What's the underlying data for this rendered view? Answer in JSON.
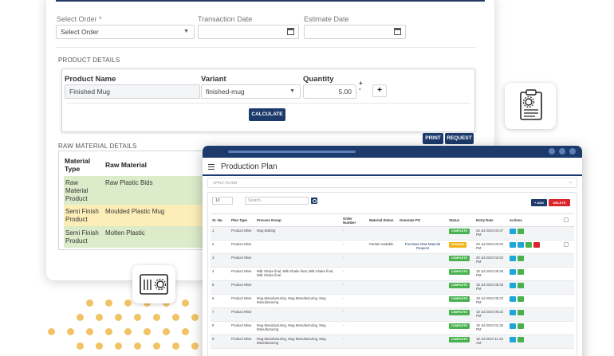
{
  "order_form": {
    "select_order_label": "Select Order *",
    "select_order_value": "Select Order",
    "transaction_date_label": "Transaction Date",
    "estimate_date_label": "Estimate Date",
    "product_details_title": "PRODUCT DETAILS",
    "product": {
      "name_header": "Product Name",
      "variant_header": "Variant",
      "quantity_header": "Quantity",
      "name_value": "Finished Mug",
      "variant_value": "finished-mug",
      "quantity_value": "5.00",
      "plus_label": "+",
      "step_up": "+",
      "step_down": "-"
    },
    "calculate_label": "CALCULATE",
    "print_label": "PRINT",
    "request_label": "REQUEST",
    "raw_material_title": "RAW MATERIAL DETAILS",
    "raw_material": {
      "col_type": "Material Type",
      "col_raw": "Raw Material",
      "rows": [
        {
          "type": "Raw Material Product",
          "name": "Raw Plastic Bids"
        },
        {
          "type": "Semi Finish Product",
          "name": "Moulded Plastic Mug"
        },
        {
          "type": "Semi Finish Product",
          "name": "Molten Plastic"
        }
      ]
    }
  },
  "production_plan": {
    "title": "Production Plan",
    "filter_label": "APPLY FILTER",
    "page_size": "10",
    "search_placeholder": "Search..",
    "add_label": "+ ADD",
    "delete_label": "DELETE",
    "columns": [
      "Sr. No.",
      "Plan Type",
      "Process Group",
      "Order Number",
      "Material Status",
      "Generate PO",
      "Status",
      "Entry Date",
      "Actions"
    ],
    "rows": [
      {
        "sr": "1",
        "plan_type": "Product Wise",
        "process_group": "Mug Making",
        "order_number": "-",
        "material_status": "",
        "generate_po": "",
        "status": "COMPLETE",
        "entry_date": "26 Jul 2024 04:27 PM"
      },
      {
        "sr": "2",
        "plan_type": "Product Wise",
        "process_group": "",
        "order_number": "-",
        "material_status": "Partial Available",
        "generate_po": "Purchase Raw Material Request",
        "status": "PENDING",
        "entry_date": "20 Jul 2024 02:02 PM"
      },
      {
        "sr": "3",
        "plan_type": "Product Wise",
        "process_group": "",
        "order_number": "-",
        "material_status": "",
        "generate_po": "",
        "status": "COMPLETE",
        "entry_date": "20 Jul 2024 02:02 PM"
      },
      {
        "sr": "4",
        "plan_type": "Product Wise",
        "process_group": "Milk Shake final, Milk Shake final, Milk Shake final, Milk Shake final",
        "order_number": "-",
        "material_status": "",
        "generate_po": "",
        "status": "COMPLETE",
        "entry_date": "18 Jul 2024 05:25 PM"
      },
      {
        "sr": "5",
        "plan_type": "Product Wise",
        "process_group": "",
        "order_number": "-",
        "material_status": "",
        "generate_po": "",
        "status": "COMPLETE",
        "entry_date": "18 Jul 2024 05:25 PM"
      },
      {
        "sr": "6",
        "plan_type": "Product Wise",
        "process_group": "Mug Manufacturing, Mug Manufacturing, Mug Manufacturing",
        "order_number": "-",
        "material_status": "",
        "generate_po": "",
        "status": "COMPLETE",
        "entry_date": "18 Jul 2024 05:22 PM"
      },
      {
        "sr": "7",
        "plan_type": "Product Wise",
        "process_group": "",
        "order_number": "-",
        "material_status": "",
        "generate_po": "",
        "status": "COMPLETE",
        "entry_date": "18 Jul 2024 05:22 PM"
      },
      {
        "sr": "8",
        "plan_type": "Product Wise",
        "process_group": "Mug Manufacturing, Mug Manufacturing, Mug Manufacturing",
        "order_number": "-",
        "material_status": "",
        "generate_po": "",
        "status": "COMPLETE",
        "entry_date": "18 Jul 2024 01:26 PM"
      },
      {
        "sr": "9",
        "plan_type": "Product Wise",
        "process_group": "Mug Manufacturing, Mug Manufacturing, Mug Manufacturing",
        "order_number": "-",
        "material_status": "",
        "generate_po": "",
        "status": "COMPLETE",
        "entry_date": "18 Jul 2024 11:45 AM"
      }
    ]
  },
  "colors": {
    "navy": "#1d3a6c",
    "complete": "#48b24f",
    "pending": "#f0b419",
    "view": "#1fa6d9",
    "delete": "#d9252b",
    "raw_green": "#dcebc9",
    "semi_yellow": "#fdeeb8",
    "dots": "#f0b94a"
  },
  "icons": [
    "clipboard-gear-icon",
    "settings-panel-icon",
    "calendar-icon",
    "search-icon",
    "hamburger-icon",
    "view-icon",
    "edit-icon",
    "delete-icon"
  ]
}
